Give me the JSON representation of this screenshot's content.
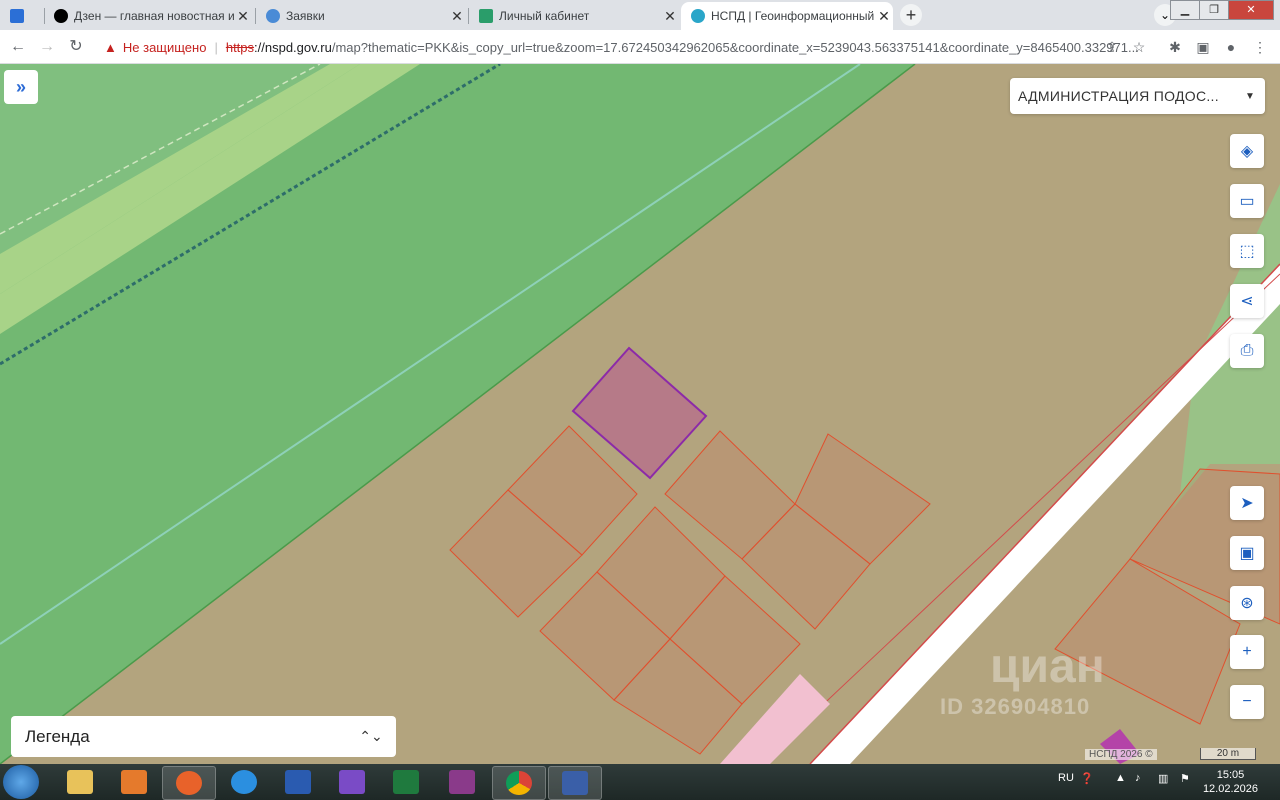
{
  "browser": {
    "tabs": [
      {
        "title": "Дзен — главная новостная инф",
        "favicon": "dzen-icon",
        "color": "#000000"
      },
      {
        "title": "Заявки",
        "favicon": "globe-icon",
        "color": "#4a8bd6"
      },
      {
        "title": "Личный кабинет",
        "favicon": "rosreestr-icon",
        "color": "#2a9d6a"
      },
      {
        "title": "НСПД | Геоинформационный п",
        "favicon": "nspd-icon",
        "color": "#2aa6c9",
        "active": true
      }
    ],
    "security_label": "Не защищено",
    "url_scheme": "https",
    "url_host": "://nspd.gov.ru",
    "url_path": "/map?thematic=PKK&is_copy_url=true&zoom=17.672450342962065&coordinate_x=5239043.563375141&coordinate_y=8465400.332971..."
  },
  "map": {
    "region_select": "АДМИНИСТРАЦИЯ ПОДОС...",
    "legend_label": "Легенда",
    "copyright": "НСПД 2026 ©",
    "scale_label": "20 m",
    "watermark_brand": "циан",
    "watermark_id": "ID 326904810",
    "tools": [
      "layers-icon",
      "ruler-icon",
      "select-area-icon",
      "share-icon",
      "print-icon",
      "locate-icon",
      "map-switch-icon",
      "search-location-icon",
      "zoom-in-icon",
      "zoom-out-icon"
    ],
    "colors": {
      "green_zone": "#72b872",
      "light_green": "#a8d388",
      "brown_zone": "#b3a47e",
      "parcel_line": "#e0502e",
      "selected_parcel": "#8c2aa8"
    }
  },
  "taskbar": {
    "lang": "RU",
    "time": "15:05",
    "date": "12.02.2026"
  }
}
